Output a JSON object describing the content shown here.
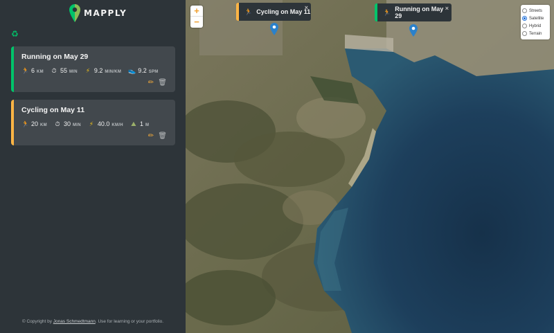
{
  "app": {
    "name": "MAPPLY"
  },
  "sidebar": {
    "workouts": [
      {
        "type": "running",
        "title": "Running on May 29",
        "stats": [
          {
            "icon": "runner-icon",
            "glyph": "🏃",
            "value": "6",
            "unit": "KM"
          },
          {
            "icon": "stopwatch-icon",
            "glyph": "⏱",
            "value": "55",
            "unit": "MIN"
          },
          {
            "icon": "lightning-icon",
            "glyph": "⚡",
            "value": "9.2",
            "unit": "MIN/KM"
          },
          {
            "icon": "footprints-icon",
            "glyph": "👟",
            "value": "9.2",
            "unit": "SPM"
          }
        ]
      },
      {
        "type": "cycling",
        "title": "Cycling on May 11",
        "stats": [
          {
            "icon": "cyclist-icon",
            "glyph": "🏃",
            "value": "20",
            "unit": "KM"
          },
          {
            "icon": "stopwatch-icon",
            "glyph": "⏱",
            "value": "30",
            "unit": "MIN"
          },
          {
            "icon": "lightning-icon",
            "glyph": "⚡",
            "value": "40.0",
            "unit": "KM/H"
          },
          {
            "icon": "mountain-icon",
            "glyph": "⛰",
            "value": "1",
            "unit": "M"
          }
        ]
      }
    ],
    "copyright": {
      "prefix": "© Copyright by ",
      "author": "Jonas Schmedtmann",
      "suffix": ". Use for learning or your portfolio."
    }
  },
  "map": {
    "zoom_in": "+",
    "zoom_out": "−",
    "popups": {
      "cycling": "Cycling on May 11",
      "running": "Running on May 29"
    },
    "popup_close": "×",
    "layers": [
      {
        "label": "Streets",
        "selected": false
      },
      {
        "label": "Satellite",
        "selected": true
      },
      {
        "label": "Hybrid",
        "selected": false
      },
      {
        "label": "Terrain",
        "selected": false
      }
    ]
  },
  "colors": {
    "running": "#00c46a",
    "cycling": "#ffb545",
    "sidebar_bg": "#2d3439",
    "card_bg": "#42484d",
    "pin": "#2a81cb"
  }
}
